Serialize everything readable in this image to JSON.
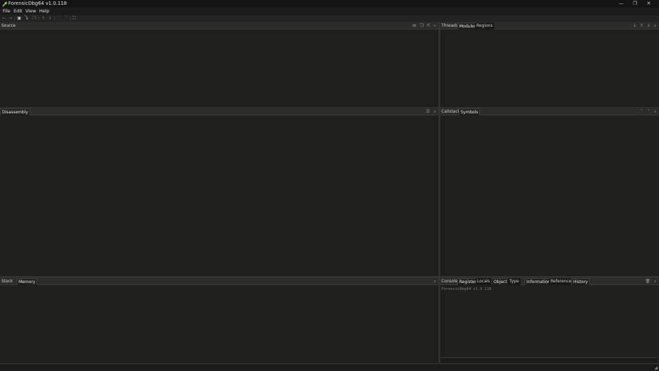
{
  "window": {
    "title": "ForensicDbg64 v1.0.118",
    "icon": "bug-icon",
    "minimize": "—",
    "maximize": "❐",
    "close": "✕"
  },
  "menu": [
    "File",
    "Edit",
    "View",
    "Help"
  ],
  "toolbar": {
    "icons": [
      "arrow-left-icon",
      "arrow-right-icon",
      "pause-icon",
      "step-into-icon",
      "copy-icon",
      "chevron-double-up-icon",
      "chevron-double-down-icon",
      "chevron-up-icon",
      "chevron-down-icon",
      "fullscreen-icon"
    ]
  },
  "panels": {
    "source": {
      "tabs": [
        "Source"
      ]
    },
    "threads": {
      "tabs": [
        "Threads",
        "Modules",
        "Regions"
      ]
    },
    "disassembly": {
      "tabs": [
        "Disassembly"
      ]
    },
    "callstack": {
      "tabs": [
        "Callstack",
        "Symbols"
      ]
    },
    "stack": {
      "tabs": [
        "Stack",
        "Memory"
      ]
    },
    "console": {
      "tabs": [
        "Console",
        "Registers",
        "Locals",
        "Object",
        "Type",
        "Information",
        "References",
        "History"
      ],
      "output": "ForensicDbg64 v1.0.118"
    }
  },
  "colors": {
    "background": "#1f201e",
    "panel_header": "#2c2d2a",
    "titlebar": "#141414",
    "accent_icon": "#7ec850"
  }
}
